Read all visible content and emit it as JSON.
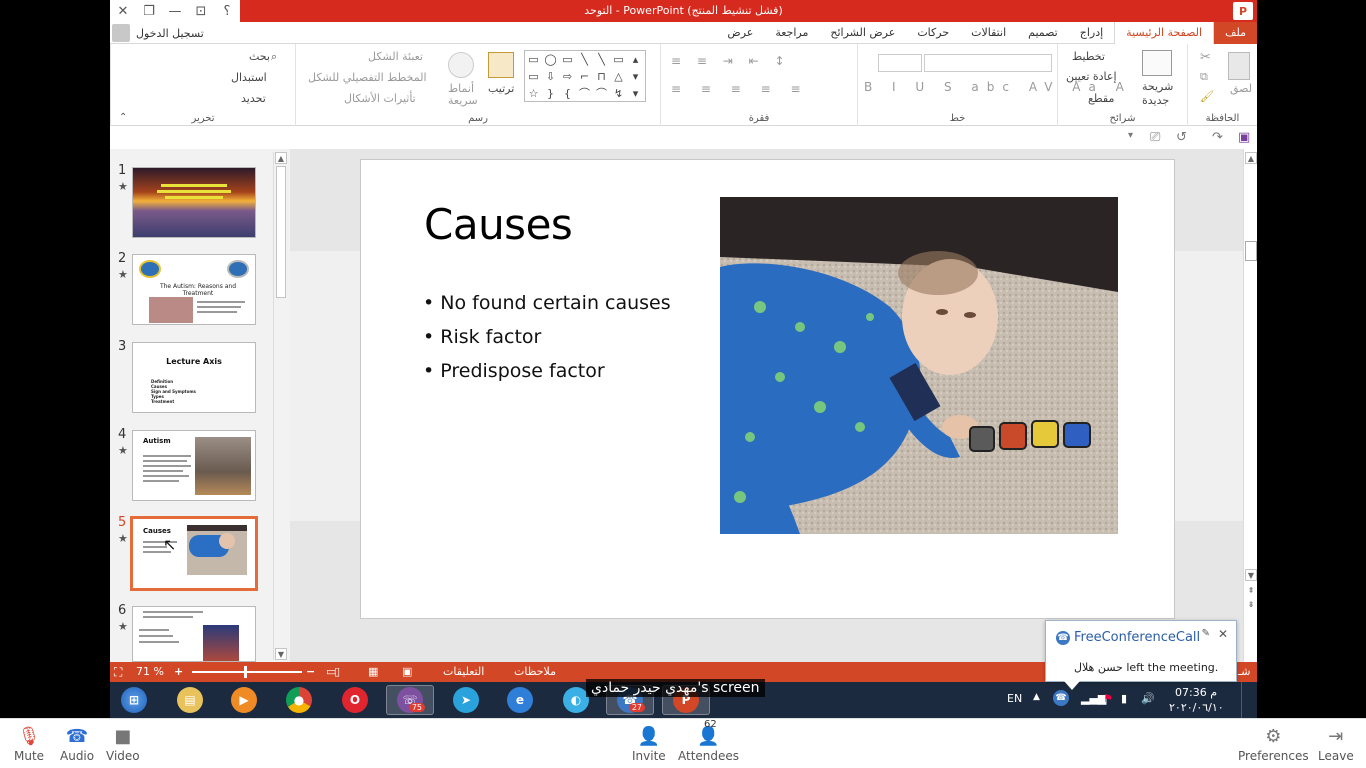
{
  "window": {
    "title": "التوحد  -  PowerPoint (فشل تنشيط المنتج)",
    "buttons": {
      "help": "؟",
      "ribbon_display": "⊡",
      "minimize": "—",
      "restore": "❐",
      "close": "✕"
    },
    "app_icon": "P"
  },
  "account": {
    "sign_in": "تسجيل الدخول"
  },
  "tabs": [
    {
      "label": "ملف"
    },
    {
      "label": "الصفحة الرئيسية"
    },
    {
      "label": "إدراج"
    },
    {
      "label": "تصميم"
    },
    {
      "label": "انتقالات"
    },
    {
      "label": "حركات"
    },
    {
      "label": "عرض الشرائح"
    },
    {
      "label": "مراجعة"
    },
    {
      "label": "عرض"
    }
  ],
  "ribbon": {
    "clipboard": {
      "label": "الحافظة",
      "paste": "لصق"
    },
    "slides": {
      "label": "شرائح",
      "new_slide": "شريحة",
      "new_slide_2": "جديدة",
      "layout": "تخطيط",
      "reset": "إعادة تعيين",
      "section": "مقطع"
    },
    "font": {
      "label": "خط"
    },
    "paragraph": {
      "label": "فقرة"
    },
    "drawing": {
      "label": "رسم",
      "arrange": "ترتيب",
      "quick_styles": "أنماط",
      "quick_styles_2": "سريعة",
      "shape_fill": "تعبئة الشكل",
      "shape_outline": "المخطط التفصيلي للشكل",
      "shape_effects": "تأثيرات الأشكال"
    },
    "editing": {
      "label": "تحرير",
      "find": "بحث",
      "replace": "استبدال",
      "select": "تحديد"
    }
  },
  "slides": [
    {
      "number": "1",
      "star": "★",
      "title": ""
    },
    {
      "number": "2",
      "star": "★",
      "title": "The Autism: Reasons and Treatment"
    },
    {
      "number": "3",
      "star": "",
      "title": "Lecture Axis",
      "items": [
        "Definition",
        "Causes",
        "Sign and Symptoms",
        "Types",
        "Treatment"
      ]
    },
    {
      "number": "4",
      "star": "★",
      "title": "Autism"
    },
    {
      "number": "5",
      "star": "★",
      "title": "Causes"
    },
    {
      "number": "6",
      "star": "★",
      "title": ""
    }
  ],
  "current_slide": {
    "title": "Causes",
    "bullets": [
      "No found certain causes",
      "Risk factor",
      "Predispose factor"
    ]
  },
  "statusbar": {
    "zoom": "71 %",
    "notes": "ملاحظات",
    "comments": "التعليقات",
    "slide_info": "شـ"
  },
  "share_caption": "مهدي حيدر حمادي's screen",
  "notification": {
    "app": "FreeConferenceCall",
    "message": "حسن هلال left the meeting."
  },
  "taskbar": {
    "apps": [
      {
        "name": "start",
        "badge": ""
      },
      {
        "name": "explorer",
        "badge": ""
      },
      {
        "name": "media-player",
        "badge": ""
      },
      {
        "name": "chrome",
        "badge": ""
      },
      {
        "name": "opera",
        "badge": ""
      },
      {
        "name": "viber",
        "badge": "75"
      },
      {
        "name": "telegram",
        "badge": ""
      },
      {
        "name": "internet-explorer",
        "badge": ""
      },
      {
        "name": "browser",
        "badge": ""
      },
      {
        "name": "freeconferencecall",
        "badge": "27"
      },
      {
        "name": "powerpoint",
        "badge": ""
      }
    ],
    "lang": "EN",
    "time": "07:36 م",
    "date": "٢٠٢٠/٠٦/١٠"
  },
  "conference": {
    "mute": "Mute",
    "audio": "Audio",
    "video": "Video",
    "invite": "Invite",
    "attendees": "Attendees",
    "attendee_count": "62",
    "preferences": "Preferences",
    "leave": "Leave"
  },
  "colors": {
    "accent": "#d24726",
    "title_bar": "#d62a1f",
    "taskbar": "#1b2a3f",
    "selected_thumb": "#e46c3a"
  }
}
